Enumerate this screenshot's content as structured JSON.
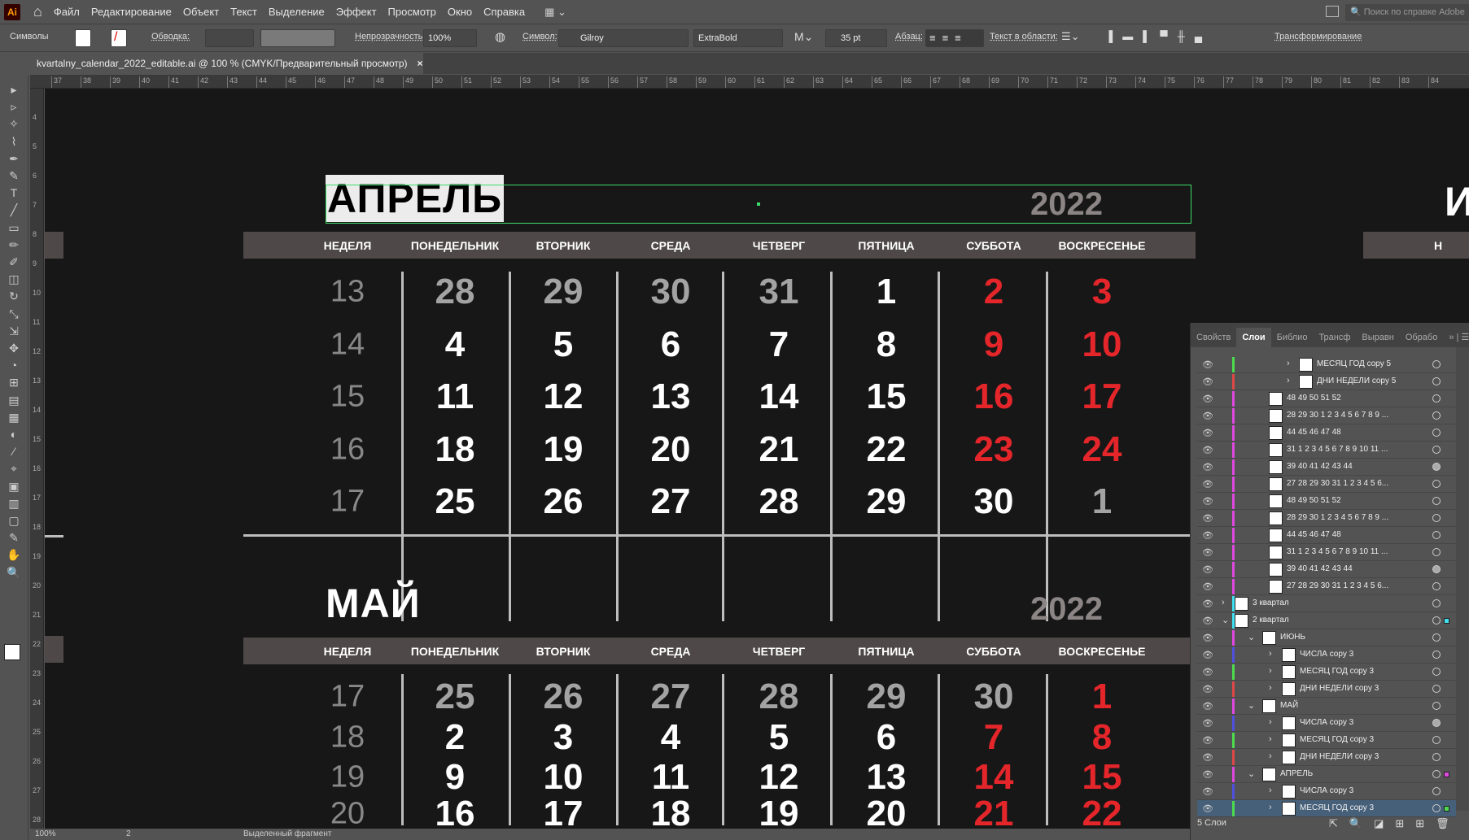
{
  "menubar": {
    "logo": "Ai",
    "items": [
      "Файл",
      "Редактирование",
      "Объект",
      "Текст",
      "Выделение",
      "Эффект",
      "Просмотр",
      "Окно",
      "Справка"
    ],
    "help_placeholder": "Поиск по справке Adobe"
  },
  "control": {
    "panel_label": "Символы",
    "stroke_label": "Обводка:",
    "opacity_label": "Непрозрачность:",
    "opacity_value": "100%",
    "symbol_label": "Символ:",
    "font_family": "Gilroy",
    "font_style": "ExtraBold",
    "font_size": "35 pt",
    "paragraph_label": "Абзац:",
    "area_text_label": "Текст в области:",
    "transform_label": "Трансформирование"
  },
  "document_tab": {
    "title": "kvartalny_calendar_2022_editable.ai @ 100 % (CMYK/Предварительный просмотр)",
    "close": "×"
  },
  "ruler_top": [
    37,
    38,
    39,
    40,
    41,
    42,
    43,
    44,
    45,
    46,
    47,
    48,
    49,
    50,
    51,
    52,
    53,
    54,
    55,
    56,
    57,
    58,
    59,
    60,
    61,
    62,
    63,
    64,
    65,
    66,
    67,
    68,
    69,
    70,
    71,
    72,
    73,
    74,
    75,
    76,
    77,
    78,
    79,
    80,
    81,
    82,
    83,
    84
  ],
  "ruler_left": [
    4,
    5,
    6,
    7,
    8,
    9,
    10,
    11,
    12,
    13,
    14,
    15,
    16,
    17,
    18,
    19,
    20,
    21,
    22,
    23,
    24,
    25,
    26,
    27,
    28
  ],
  "calendar": {
    "weekdays": [
      "НЕДЕЛЯ",
      "ПОНЕДЕЛЬНИК",
      "ВТОРНИК",
      "СРЕДА",
      "ЧЕТВЕРГ",
      "ПЯТНИЦА",
      "СУББОТА",
      "ВОСКРЕСЕНЬЕ"
    ],
    "colors": {
      "band": "#4f4848",
      "weekend": "#e4262b",
      "muted": "#a3a3a3",
      "year": "#8c8585",
      "selection": "#3ddc6a"
    },
    "months": [
      {
        "title": "АПРЕЛЬ",
        "year": "2022",
        "rows": [
          [
            "13",
            "28m",
            "29m",
            "30m",
            "31m",
            "1",
            "2r",
            "3r"
          ],
          [
            "14",
            "4",
            "5",
            "6",
            "7",
            "8",
            "9r",
            "10r"
          ],
          [
            "15",
            "11",
            "12",
            "13",
            "14",
            "15",
            "16r",
            "17r"
          ],
          [
            "16",
            "18",
            "19",
            "20",
            "21",
            "22",
            "23r",
            "24r"
          ],
          [
            "17",
            "25",
            "26",
            "27",
            "28",
            "29",
            "30",
            "1m"
          ]
        ]
      },
      {
        "title": "МАЙ",
        "year": "2022",
        "rows": [
          [
            "17",
            "25m",
            "26m",
            "27m",
            "28m",
            "29m",
            "30m",
            "1r"
          ],
          [
            "18",
            "2",
            "3",
            "4",
            "5",
            "6",
            "7r",
            "8r"
          ],
          [
            "19",
            "9",
            "10",
            "11",
            "12",
            "13",
            "14r",
            "15r"
          ],
          [
            "20",
            "16",
            "17",
            "18",
            "19",
            "20",
            "21r",
            "22r"
          ]
        ]
      }
    ],
    "next_title_fragment": "И",
    "next_header_fragment": "Н"
  },
  "status": {
    "zoom": "100%",
    "page": "2",
    "mode": "Выделенный фрагмент"
  },
  "layers_panel": {
    "tabs": [
      "Свойств",
      "Слои",
      "Библио",
      "Трансф",
      "Выравн",
      "Обрабо"
    ],
    "active_tab": "Слои",
    "footer": "5 Слои",
    "rows": [
      {
        "name": "МЕСЯЦ  ГОД copy 5",
        "level": 3,
        "chev": ">",
        "color": "#4ddc4d"
      },
      {
        "name": "ДНИ НЕДЕЛИ copy 5",
        "level": 3,
        "chev": ">",
        "color": "#e04848"
      },
      {
        "name": "48 49 50 51 52",
        "level": 2,
        "color": "#e048e0"
      },
      {
        "name": "28 29 30 1 2 3 4 5 6 7 8 9 ...",
        "level": 2,
        "color": "#e048e0"
      },
      {
        "name": "44 45 46 47 48",
        "level": 2,
        "color": "#e048e0"
      },
      {
        "name": "31 1 2 3 4 5 6 7 8 9 10 11 ...",
        "level": 2,
        "color": "#e048e0"
      },
      {
        "name": "39 40 41 42 43 44",
        "level": 2,
        "color": "#e048e0",
        "filled": true
      },
      {
        "name": "27 28 29 30 31 1 2 3 4 5 6...",
        "level": 2,
        "color": "#e048e0"
      },
      {
        "name": "48 49 50 51 52",
        "level": 2,
        "color": "#e048e0"
      },
      {
        "name": "28 29 30 1 2 3 4 5 6 7 8 9 ...",
        "level": 2,
        "color": "#e048e0"
      },
      {
        "name": "44 45 46 47 48",
        "level": 2,
        "color": "#e048e0"
      },
      {
        "name": "31 1 2 3 4 5 6 7 8 9 10 11 ...",
        "level": 2,
        "color": "#e048e0"
      },
      {
        "name": "39 40 41 42 43 44",
        "level": 2,
        "color": "#e048e0",
        "filled": true
      },
      {
        "name": "27 28 29 30 31 1 2 3 4 5 6...",
        "level": 2,
        "color": "#e048e0"
      },
      {
        "name": "3 квартал",
        "level": 0,
        "chev": ">",
        "color": "#40e0f0"
      },
      {
        "name": "2 квартал",
        "level": 0,
        "chev": "v",
        "color": "#40e0f0",
        "sq": "#40e0f0"
      },
      {
        "name": "ИЮНЬ",
        "level": 1,
        "chev": "v",
        "color": "#e048e0"
      },
      {
        "name": "ЧИСЛА copy 3",
        "level": 2,
        "chev": ">",
        "color": "#5050e0"
      },
      {
        "name": "МЕСЯЦ  ГОД copy 3",
        "level": 2,
        "chev": ">",
        "color": "#4ddc4d"
      },
      {
        "name": "ДНИ НЕДЕЛИ copy 3",
        "level": 2,
        "chev": ">",
        "color": "#e04848"
      },
      {
        "name": "МАЙ",
        "level": 1,
        "chev": "v",
        "color": "#e048e0"
      },
      {
        "name": "ЧИСЛА copy 3",
        "level": 2,
        "chev": ">",
        "color": "#5050e0",
        "filled": true
      },
      {
        "name": "МЕСЯЦ  ГОД copy 3",
        "level": 2,
        "chev": ">",
        "color": "#4ddc4d"
      },
      {
        "name": "ДНИ НЕДЕЛИ copy 3",
        "level": 2,
        "chev": ">",
        "color": "#e04848"
      },
      {
        "name": "АПРЕЛЬ",
        "level": 1,
        "chev": "v",
        "color": "#e048e0",
        "sq": "#e048e0"
      },
      {
        "name": "ЧИСЛА copy 3",
        "level": 2,
        "chev": ">",
        "color": "#5050e0"
      },
      {
        "name": "МЕСЯЦ  ГОД copy 3",
        "level": 2,
        "chev": ">",
        "color": "#4ddc4d",
        "sq": "#4ddc4d",
        "selected": true
      }
    ]
  }
}
